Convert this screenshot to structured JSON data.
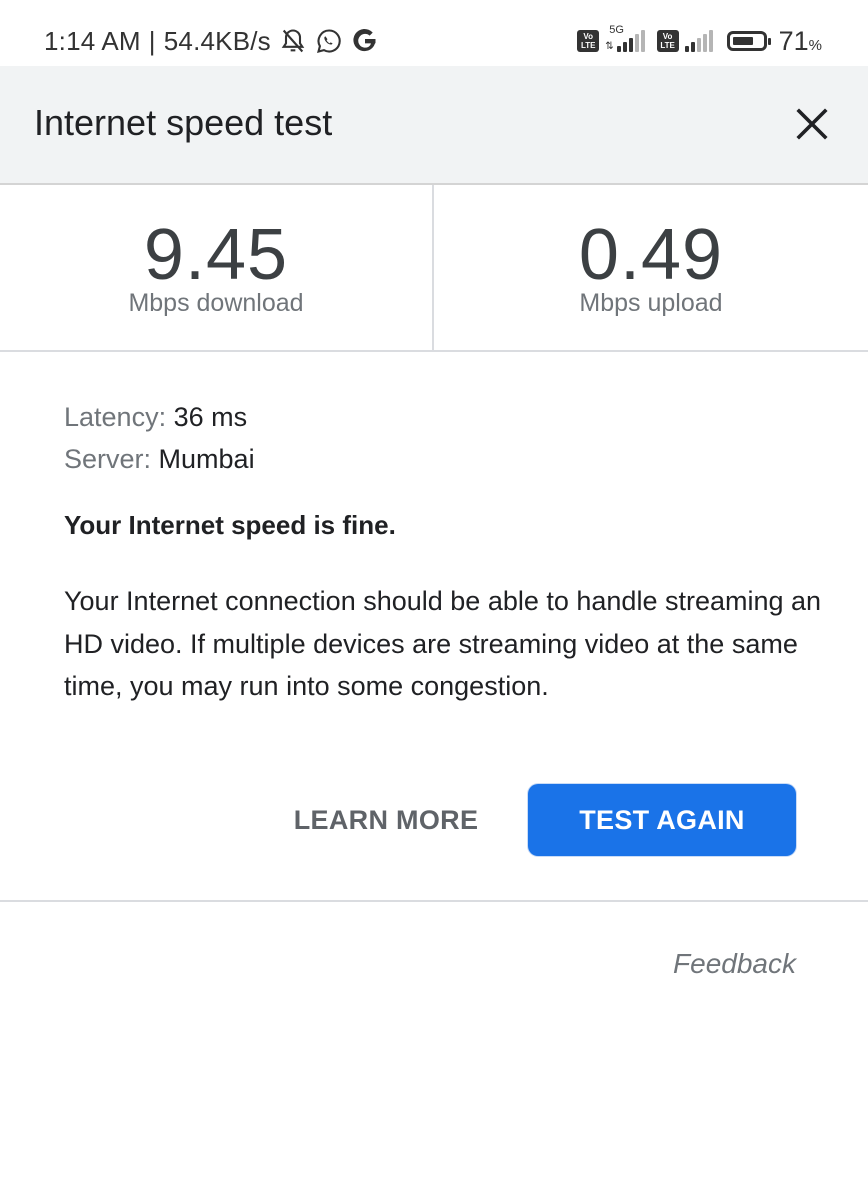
{
  "status_bar": {
    "time": "1:14 AM",
    "separator": "|",
    "net_speed": "54.4KB/s",
    "left_icons": [
      "bell-off-icon",
      "whatsapp-icon",
      "google-icon"
    ],
    "sim1": {
      "badge_top": "Vo",
      "badge_bottom": "LTE",
      "network": "5G",
      "signal_bars_filled": 3,
      "signal_bars_total": 5
    },
    "sim2": {
      "badge_top": "Vo",
      "badge_bottom": "LTE",
      "signal_bars_filled": 2,
      "signal_bars_total": 5
    },
    "battery_percent": 71,
    "battery_value": "71",
    "battery_unit": "%"
  },
  "header": {
    "title": "Internet speed test",
    "close_icon": "close-icon"
  },
  "results": {
    "download": {
      "value": "9.45",
      "label": "Mbps download"
    },
    "upload": {
      "value": "0.49",
      "label": "Mbps upload"
    }
  },
  "details": {
    "latency_label": "Latency:",
    "latency_value": "36 ms",
    "server_label": "Server:",
    "server_value": "Mumbai"
  },
  "verdict": "Your Internet speed is fine.",
  "description": "Your Internet connection should be able to handle streaming an HD video. If multiple devices are streaming video at the same time, you may run into some congestion.",
  "actions": {
    "learn_more": "LEARN MORE",
    "test_again": "TEST AGAIN",
    "primary_color": "#1a73e8"
  },
  "footer": {
    "feedback": "Feedback"
  }
}
